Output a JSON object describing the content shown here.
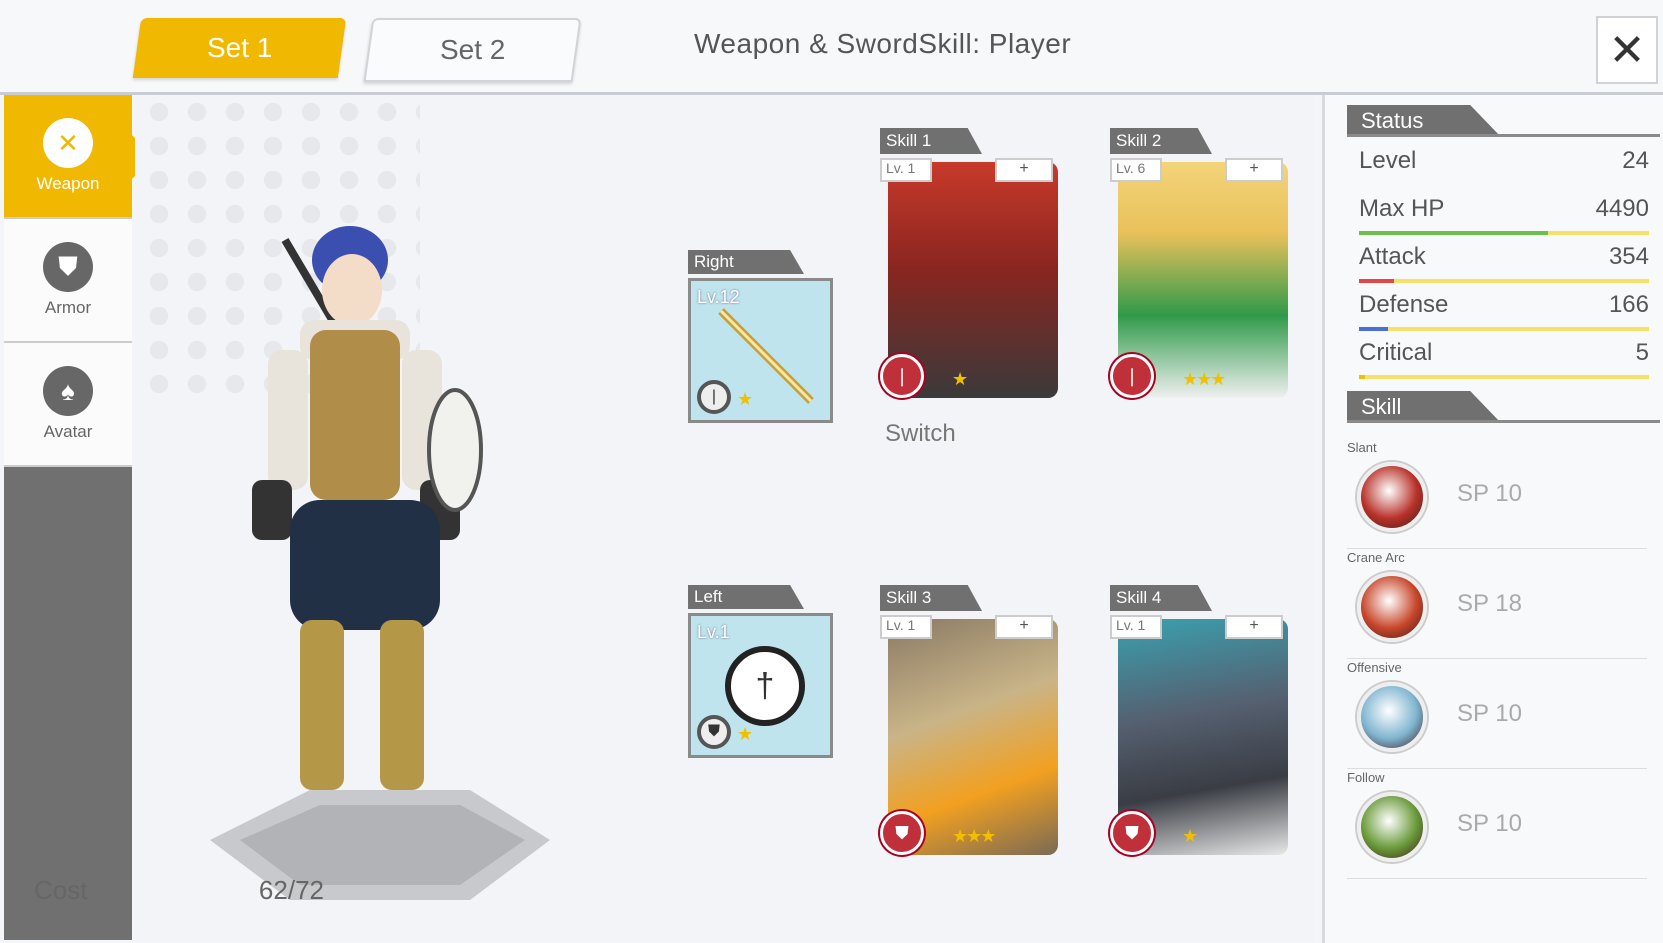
{
  "header": {
    "tabs": [
      {
        "label": "Set 1",
        "active": true
      },
      {
        "label": "Set 2",
        "active": false
      }
    ],
    "title": "Weapon & SwordSkill: Player",
    "close_icon": "close-icon"
  },
  "sidebar": {
    "items": [
      {
        "label": "Weapon",
        "icon": "crossed-swords-icon",
        "active": true
      },
      {
        "label": "Armor",
        "icon": "shield-icon",
        "active": false
      },
      {
        "label": "Avatar",
        "icon": "shirt-icon",
        "active": false
      }
    ]
  },
  "weapons": {
    "right": {
      "label": "Right",
      "level": "Lv.12",
      "stars": 1
    },
    "left": {
      "label": "Left",
      "level": "Lv.1",
      "stars": 1
    }
  },
  "skills": [
    {
      "label": "Skill 1",
      "level": "Lv. 1",
      "stars": 1,
      "switch_label": "Switch"
    },
    {
      "label": "Skill 2",
      "level": "Lv. 6",
      "stars": 3
    },
    {
      "label": "Skill 3",
      "level": "Lv. 1",
      "stars": 3
    },
    {
      "label": "Skill 4",
      "level": "Lv. 1",
      "stars": 1
    }
  ],
  "plus_label": "+",
  "status": {
    "header": "Status",
    "rows": [
      {
        "label": "Level",
        "value": "24"
      },
      {
        "label": "Max HP",
        "value": "4490",
        "fill": 0.65,
        "color": "#6cc04a"
      },
      {
        "label": "Attack",
        "value": "354",
        "fill": 0.12,
        "color": "#e04848"
      },
      {
        "label": "Defense",
        "value": "166",
        "fill": 0.1,
        "color": "#4870d8"
      },
      {
        "label": "Critical",
        "value": "5",
        "fill": 0.02,
        "color": "#f0c000"
      }
    ]
  },
  "skill_panel": {
    "header": "Skill",
    "rows": [
      {
        "name": "Slant",
        "sp": "SP 10",
        "color": "#b8322a"
      },
      {
        "name": "Crane Arc",
        "sp": "SP 18",
        "color": "#c8462a"
      },
      {
        "name": "Offensive",
        "sp": "SP 10",
        "color": "#7fb5d0"
      },
      {
        "name": "Follow",
        "sp": "SP 10",
        "color": "#6a9a3a"
      }
    ],
    "cost_label": "Cost",
    "cost_value": "62/72"
  }
}
